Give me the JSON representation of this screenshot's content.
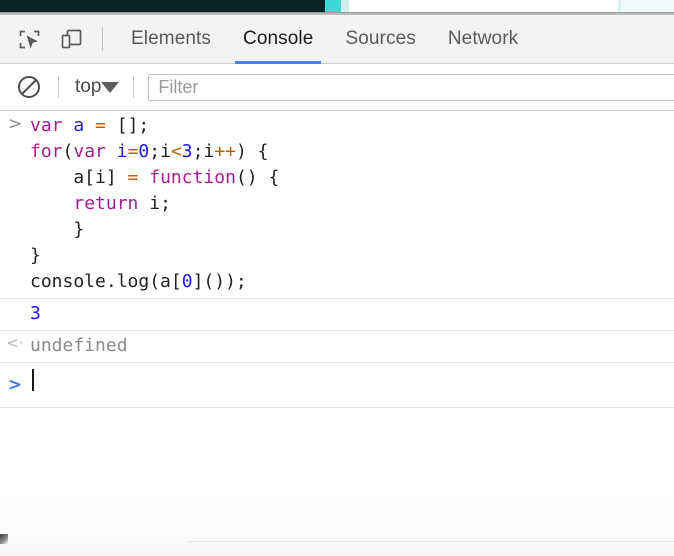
{
  "page_strip": {
    "dark_color": "#0b2426",
    "accent_color": "#3fd6d6"
  },
  "toolbar": {
    "icons": [
      {
        "name": "inspect-element-icon",
        "label": "Inspect element"
      },
      {
        "name": "device-toolbar-icon",
        "label": "Toggle device toolbar"
      }
    ],
    "tabs": [
      {
        "label": "Elements",
        "active": false
      },
      {
        "label": "Console",
        "active": true
      },
      {
        "label": "Sources",
        "active": false
      },
      {
        "label": "Network",
        "active": false
      }
    ],
    "active_tab": "Console",
    "active_underline_color": "#4285f4"
  },
  "filter_bar": {
    "clear_icon": "clear-console-icon",
    "context_value": "top",
    "dropdown_icon": "caret-down-icon",
    "filter_placeholder": "Filter",
    "filter_value": ""
  },
  "console": {
    "entries": [
      {
        "type": "input",
        "marker": ">",
        "lines": [
          [
            {
              "t": "var ",
              "c": "kw"
            },
            {
              "t": "a",
              "c": "var"
            },
            {
              "t": " ",
              "c": "pln"
            },
            {
              "t": "=",
              "c": "op"
            },
            {
              "t": " [];",
              "c": "pln"
            }
          ],
          [
            {
              "t": "for",
              "c": "kw"
            },
            {
              "t": "(",
              "c": "pln"
            },
            {
              "t": "var ",
              "c": "kw"
            },
            {
              "t": "i",
              "c": "var"
            },
            {
              "t": "=",
              "c": "op"
            },
            {
              "t": "0",
              "c": "num"
            },
            {
              "t": ";i",
              "c": "pln"
            },
            {
              "t": "<",
              "c": "op"
            },
            {
              "t": "3",
              "c": "num"
            },
            {
              "t": ";i",
              "c": "pln"
            },
            {
              "t": "++",
              "c": "op"
            },
            {
              "t": ") {",
              "c": "pln"
            }
          ],
          [
            {
              "t": "    a[i] ",
              "c": "pln"
            },
            {
              "t": "=",
              "c": "op"
            },
            {
              "t": " ",
              "c": "pln"
            },
            {
              "t": "function",
              "c": "kw"
            },
            {
              "t": "() {",
              "c": "pln"
            }
          ],
          [
            {
              "t": "    ",
              "c": "pln"
            },
            {
              "t": "return",
              "c": "kw"
            },
            {
              "t": " i;",
              "c": "pln"
            }
          ],
          [
            {
              "t": "    }",
              "c": "pln"
            }
          ],
          [
            {
              "t": "}",
              "c": "pln"
            }
          ],
          [
            {
              "t": "console.log(a[",
              "c": "pln"
            },
            {
              "t": "0",
              "c": "num"
            },
            {
              "t": "]());",
              "c": "pln"
            }
          ]
        ]
      },
      {
        "type": "log",
        "marker": "",
        "text": "3"
      },
      {
        "type": "result",
        "marker": "<·",
        "text": "undefined"
      },
      {
        "type": "prompt",
        "marker": ">",
        "text": ""
      }
    ],
    "log_value": "3",
    "result_value": "undefined",
    "prompt_marker": ">",
    "input_marker": ">",
    "result_marker": "<·"
  },
  "colors": {
    "keyword": "#a71d8f",
    "variable": "#2424c8",
    "operator": "#c06000",
    "number": "#1a1ae0",
    "plain": "#222222",
    "gray_text": "#8a8a8a",
    "prompt_blue": "#3b78e7",
    "tab_underline": "#4285f4"
  }
}
